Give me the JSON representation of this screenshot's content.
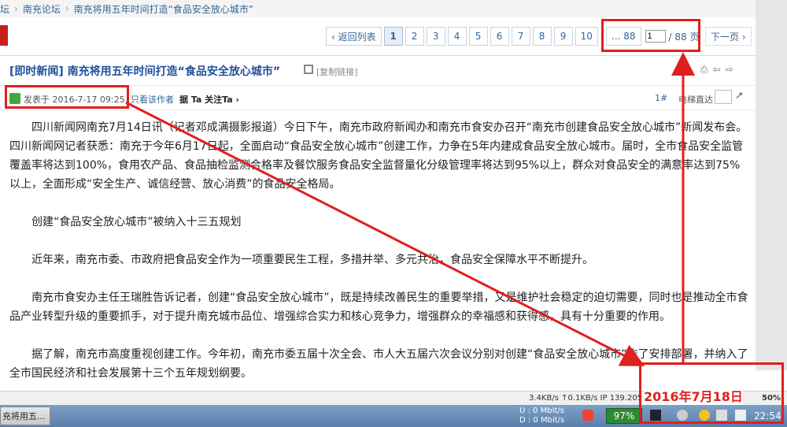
{
  "breadcrumb": {
    "items": [
      "坛",
      "南充论坛",
      "南充将用五年时间打造“食品安全放心城市”"
    ],
    "separator": "›"
  },
  "pager": {
    "prev": "‹ 返回列表",
    "pages": [
      "1",
      "2",
      "3",
      "4",
      "5",
      "6",
      "7",
      "8",
      "9",
      "10"
    ],
    "current": "1",
    "ellipsis": "... 88",
    "input_value": "1",
    "total": "/ 88 页",
    "next": "下一页 ›"
  },
  "post": {
    "title": "[即时新闻] 南充将用五年时间打造“食品安全放心城市”",
    "copy_link": "[复制链接]",
    "posted_at": "发表于 2016-7-17 09:25",
    "only_author": "只看该作者",
    "follow": "据 Ta 关注Ta ›",
    "floor": "1#",
    "direct_to": "电梯直达"
  },
  "content": {
    "p1": "四川新闻网南充7月14日讯（记者邓成满摄影报道）今日下午，南充市政府新闻办和南充市食安办召开“南充市创建食品安全放心城市”新闻发布会。四川新闻网记者获悉：南充于今年6月17日起，全面启动“食品安全放心城市”创建工作，力争在5年内建成食品安全放心城市。届时，全市食品安全监管覆盖率将达到100%，食用农产品、食品抽检监测合格率及餐饮服务食品安全监督量化分级管理率将达到95%以上，群众对食品安全的满意率达到75%以上，全面形成“安全生产、诚信经营、放心消费”的食品安全格局。",
    "p2": "创建“食品安全放心城市”被纳入十三五规划",
    "p3": "近年来，南充市委、市政府把食品安全作为一项重要民生工程，多措并举、多元共治，食品安全保障水平不断提升。",
    "p4": "南充市食安办主任王瑞胜告诉记者，创建“食品安全放心城市”，既是持续改善民生的重要举措，又是维护社会稳定的迫切需要，同时也是推动全市食品产业转型升级的重要抓手，对于提升南充城市品位、增强综合实力和核心竞争力，增强群众的幸福感和获得感，具有十分重要的作用。",
    "p5": "据了解，南充市高度重视创建工作。今年初，南充市委五届十次全会、市人大五届六次会议分别对创建“食品安全放心城市”作了安排部署，并纳入了全市国民经济和社会发展第十三个五年规划纲要。"
  },
  "annotation": {
    "date_label": "2016年7月18日"
  },
  "status": {
    "speed": "3.4KB/s ↑0.1KB/s IP 139.205",
    "zoom": "50%"
  },
  "taskbar": {
    "task": "充将用五...",
    "net_u": "U :     0 Mbit/s",
    "net_d": "D :     0 Mbit/s",
    "battery": "97%",
    "clock": "22:54"
  },
  "colors": {
    "highlight": "#e01f1f",
    "link": "#336699",
    "title": "#1e4f9c"
  }
}
